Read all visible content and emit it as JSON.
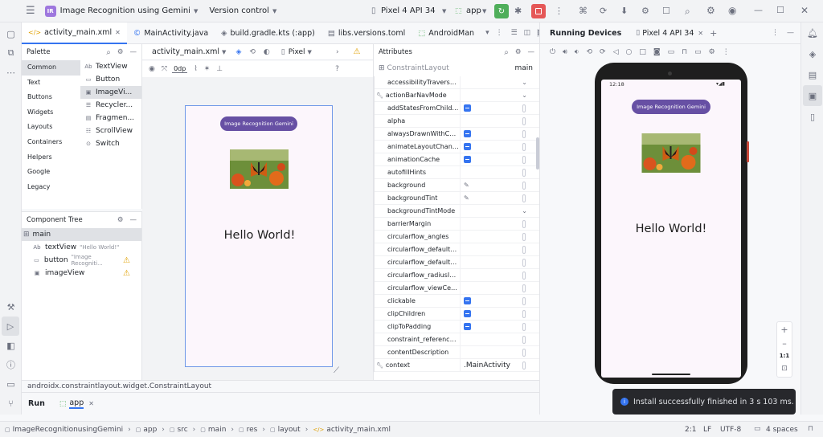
{
  "titlebar": {
    "project_badge": "IR",
    "project_name": "Image Recognition using Gemini",
    "vcs": "Version control",
    "device": "Pixel 4 API 34",
    "run_config": "app"
  },
  "tabs": [
    {
      "label": "activity_main.xml",
      "icon": "xml-icon"
    },
    {
      "label": "MainActivity.java",
      "icon": "class-icon"
    },
    {
      "label": "build.gradle.kts (:app)",
      "icon": "gradle-icon"
    },
    {
      "label": "libs.versions.toml",
      "icon": "toml-icon"
    },
    {
      "label": "AndroidMan",
      "icon": "manifest-icon"
    }
  ],
  "palette": {
    "title": "Palette",
    "categories": [
      "Common",
      "Text",
      "Buttons",
      "Widgets",
      "Layouts",
      "Containers",
      "Helpers",
      "Google",
      "Legacy"
    ],
    "items": [
      {
        "prefix": "Ab",
        "label": "TextView"
      },
      {
        "prefix": "▭",
        "label": "Button"
      },
      {
        "prefix": "▣",
        "label": "ImageVi..."
      },
      {
        "prefix": "☰",
        "label": "Recycler..."
      },
      {
        "prefix": "▤",
        "label": "Fragmen..."
      },
      {
        "prefix": "☷",
        "label": "ScrollView"
      },
      {
        "prefix": "⊙",
        "label": "Switch"
      }
    ]
  },
  "component_tree": {
    "title": "Component Tree",
    "root": "main",
    "children": [
      {
        "prefix": "Ab",
        "label": "textView",
        "hint": "\"Hello World!\"",
        "warn": false
      },
      {
        "prefix": "▭",
        "label": "button",
        "hint": "\"Image Recogniti...",
        "warn": true
      },
      {
        "prefix": "▣",
        "label": "imageView",
        "hint": "",
        "warn": true
      }
    ]
  },
  "design": {
    "file": "activity_main.xml",
    "device": "Pixel",
    "margin": "0dp",
    "button_label": "Image Recognition Gemini",
    "hello": "Hello World!"
  },
  "attributes": {
    "title": "Attributes",
    "class": "ConstraintLayout",
    "id": "main",
    "rows": [
      {
        "name": "accessibilityTraversalBe...",
        "val": "",
        "type": "dropdown"
      },
      {
        "name": "actionBarNavMode",
        "val": "",
        "type": "dropdown",
        "wrench": true
      },
      {
        "name": "addStatesFromChildren",
        "val": "",
        "type": "flag"
      },
      {
        "name": "alpha",
        "val": "",
        "type": "text"
      },
      {
        "name": "alwaysDrawnWithCache",
        "val": "",
        "type": "flag"
      },
      {
        "name": "animateLayoutChanges",
        "val": "",
        "type": "flag"
      },
      {
        "name": "animationCache",
        "val": "",
        "type": "flag"
      },
      {
        "name": "autofillHints",
        "val": "",
        "type": "text"
      },
      {
        "name": "background",
        "val": "",
        "type": "picker"
      },
      {
        "name": "backgroundTint",
        "val": "",
        "type": "picker"
      },
      {
        "name": "backgroundTintMode",
        "val": "",
        "type": "dropdown"
      },
      {
        "name": "barrierMargin",
        "val": "",
        "type": "text"
      },
      {
        "name": "circularflow_angles",
        "val": "",
        "type": "text"
      },
      {
        "name": "circularflow_defaultAngle",
        "val": "",
        "type": "text"
      },
      {
        "name": "circularflow_defaultRadi...",
        "val": "",
        "type": "text"
      },
      {
        "name": "circularflow_radiusInDP",
        "val": "",
        "type": "text"
      },
      {
        "name": "circularflow_viewCenter",
        "val": "",
        "type": "text"
      },
      {
        "name": "clickable",
        "val": "",
        "type": "flag"
      },
      {
        "name": "clipChildren",
        "val": "",
        "type": "flag"
      },
      {
        "name": "clipToPadding",
        "val": "",
        "type": "flag"
      },
      {
        "name": "constraint_referenced_t...",
        "val": "",
        "type": "text"
      },
      {
        "name": "contentDescription",
        "val": "",
        "type": "text"
      },
      {
        "name": "context",
        "val": ".MainActivity",
        "type": "text",
        "wrench": true
      }
    ]
  },
  "running_devices": {
    "title": "Running Devices",
    "tab": "Pixel 4 API 34",
    "status_time": "12:18",
    "button_label": "Image Recognition Gemini",
    "hello": "Hello World!",
    "zoom_label": "1:1"
  },
  "notification": "Install successfully finished in 3 s 103 ms.",
  "status_line": "androidx.constraintlayout.widget.ConstraintLayout",
  "run_tabs": {
    "run": "Run",
    "app": "app"
  },
  "breadcrumb": [
    "ImageRecognitionusingGemini",
    "app",
    "src",
    "main",
    "res",
    "layout",
    "activity_main.xml"
  ],
  "statusbar": {
    "pos": "2:1",
    "line_sep": "LF",
    "encoding": "UTF-8",
    "indent": "4 spaces"
  },
  "colors": {
    "accent": "#3574f0",
    "button_purple": "#6750a4",
    "run_green": "#4fae5a",
    "stop_red": "#e55757"
  }
}
